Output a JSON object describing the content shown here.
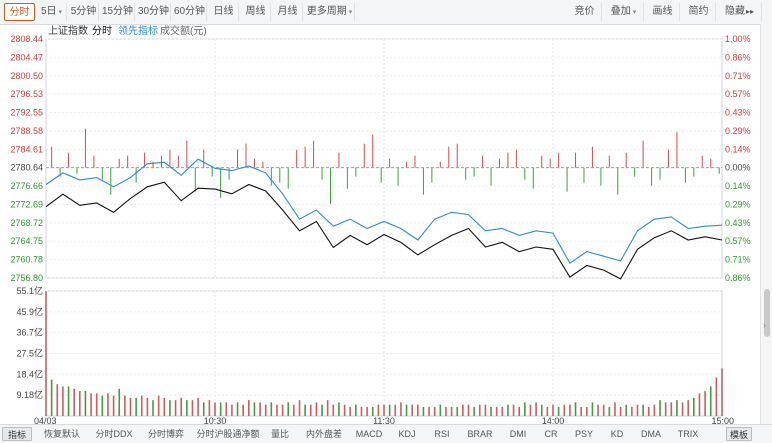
{
  "toolbar": {
    "left": [
      {
        "label": "分时",
        "active": true,
        "dropdown": false
      },
      {
        "label": "5日",
        "active": false,
        "dropdown": true
      },
      {
        "label": "5分钟",
        "active": false,
        "dropdown": false
      },
      {
        "label": "15分钟",
        "active": false,
        "dropdown": false
      },
      {
        "label": "30分钟",
        "active": false,
        "dropdown": false
      },
      {
        "label": "60分钟",
        "active": false,
        "dropdown": false
      },
      {
        "label": "日线",
        "active": false,
        "dropdown": false
      },
      {
        "label": "周线",
        "active": false,
        "dropdown": false
      },
      {
        "label": "月线",
        "active": false,
        "dropdown": false
      },
      {
        "label": "更多周期",
        "active": false,
        "dropdown": true
      }
    ],
    "right": [
      {
        "label": "竞价",
        "dropdown": false
      },
      {
        "label": "叠加",
        "dropdown": true
      },
      {
        "label": "画线",
        "dropdown": false
      },
      {
        "label": "简约",
        "dropdown": false
      },
      {
        "label": "隐藏",
        "dropdown": false,
        "icon": "double-right-arrow-icon"
      }
    ],
    "icon_glyph": "▸▸"
  },
  "legend": {
    "index_name": "上证指数",
    "line_name": "分时",
    "lead_name": "领先指标",
    "volume_name": "成交额(元)",
    "colors": {
      "line": "#111111",
      "lead": "#2b8bd8",
      "volume": "#777777"
    }
  },
  "chart_data": {
    "type": "line",
    "prev_close": 2780.64,
    "y_left_ticks": [
      "2808.44",
      "2804.47",
      "2800.50",
      "2796.53",
      "2792.55",
      "2788.58",
      "2784.61",
      "2780.64",
      "2776.66",
      "2772.69",
      "2768.72",
      "2764.75",
      "2760.78",
      "2756.80"
    ],
    "y_right_ticks": [
      "1.00%",
      "0.86%",
      "0.71%",
      "0.57%",
      "0.43%",
      "0.29%",
      "0.14%",
      "0.00%",
      "0.14%",
      "0.29%",
      "0.43%",
      "0.57%",
      "0.71%",
      "0.86%"
    ],
    "ylim": [
      2756.8,
      2808.44
    ],
    "x_labels": [
      "04/03",
      "10:30",
      "11:30",
      "14:00",
      "15:00"
    ],
    "minutes_total": 240,
    "price_series": {
      "name": "分时",
      "t": [
        0,
        6,
        12,
        18,
        24,
        30,
        36,
        42,
        48,
        54,
        60,
        66,
        72,
        78,
        84,
        90,
        96,
        102,
        108,
        114,
        120,
        126,
        132,
        138,
        144,
        150,
        156,
        162,
        168,
        174,
        180,
        186,
        192,
        198,
        204,
        210,
        216,
        222,
        228,
        234,
        240
      ],
      "values": [
        2772.2,
        2774.9,
        2772.5,
        2773.0,
        2771.0,
        2774.0,
        2776.5,
        2777.5,
        2773.5,
        2776.2,
        2776.0,
        2775.0,
        2777.0,
        2775.6,
        2771.5,
        2767.0,
        2769.0,
        2763.4,
        2766.0,
        2764.0,
        2766.2,
        2764.5,
        2761.8,
        2764.0,
        2766.0,
        2767.5,
        2763.5,
        2764.5,
        2762.5,
        2763.5,
        2763.0,
        2757.0,
        2759.5,
        2758.5,
        2756.6,
        2763.0,
        2765.5,
        2767.0,
        2765.0,
        2765.7,
        2765.0
      ]
    },
    "lead_series": {
      "name": "领先指标",
      "t": [
        0,
        6,
        12,
        18,
        24,
        30,
        36,
        42,
        48,
        54,
        60,
        66,
        72,
        78,
        84,
        90,
        96,
        102,
        108,
        114,
        120,
        126,
        132,
        138,
        144,
        150,
        156,
        162,
        168,
        174,
        180,
        186,
        192,
        198,
        204,
        210,
        216,
        222,
        228,
        234,
        240
      ],
      "values": [
        2777.0,
        2779.5,
        2778.0,
        2778.5,
        2776.5,
        2778.5,
        2781.5,
        2781.8,
        2779.0,
        2782.5,
        2780.5,
        2780.0,
        2781.0,
        2779.5,
        2775.0,
        2769.5,
        2771.5,
        2768.0,
        2769.5,
        2767.5,
        2769.0,
        2767.5,
        2765.0,
        2769.5,
        2771.0,
        2770.5,
        2767.0,
        2767.5,
        2766.0,
        2767.0,
        2766.5,
        2760.0,
        2762.5,
        2761.5,
        2760.5,
        2767.0,
        2769.5,
        2770.0,
        2767.5,
        2768.0,
        2768.2
      ]
    },
    "diff_bars": {
      "t": [
        2,
        5,
        8,
        11,
        14,
        17,
        20,
        23,
        26,
        29,
        32,
        35,
        38,
        41,
        44,
        47,
        50,
        53,
        56,
        59,
        62,
        65,
        68,
        71,
        74,
        77,
        80,
        83,
        86,
        89,
        92,
        95,
        98,
        101,
        104,
        107,
        110,
        113,
        116,
        119,
        122,
        125,
        128,
        131,
        134,
        137,
        140,
        143,
        146,
        149,
        152,
        155,
        158,
        161,
        164,
        167,
        170,
        173,
        176,
        179,
        182,
        185,
        188,
        191,
        194,
        197,
        200,
        203,
        206,
        209,
        212,
        215,
        218,
        221,
        224,
        227,
        230,
        233,
        236,
        239
      ],
      "values": [
        7,
        -3,
        5,
        -2,
        13,
        4,
        -4,
        -9,
        3,
        4,
        -5,
        5,
        2,
        4,
        6,
        4,
        9,
        -8,
        6,
        -3,
        -10,
        -4,
        6,
        8,
        3,
        2,
        -6,
        -5,
        -7,
        6,
        7,
        9,
        -4,
        -12,
        5,
        -7,
        -3,
        8,
        11,
        -5,
        3,
        -6,
        2,
        4,
        -9,
        -5,
        2,
        7,
        8,
        -4,
        -3,
        4,
        -6,
        3,
        5,
        6,
        -4,
        -7,
        4,
        3,
        5,
        -8,
        5,
        -5,
        7,
        -6,
        4,
        -9,
        5,
        -3,
        9,
        -6,
        -4,
        6,
        12,
        -5,
        -3,
        4,
        3,
        -2
      ]
    },
    "volume": {
      "y_ticks": [
        "55.1亿",
        "45.9亿",
        "36.7亿",
        "27.5亿",
        "18.4亿",
        "9.18亿"
      ],
      "ylim": [
        0,
        55.1
      ],
      "t": [
        0,
        2,
        4,
        6,
        8,
        10,
        12,
        14,
        16,
        18,
        20,
        22,
        24,
        26,
        28,
        30,
        32,
        34,
        36,
        38,
        40,
        42,
        44,
        46,
        48,
        50,
        52,
        54,
        56,
        58,
        60,
        62,
        64,
        66,
        68,
        70,
        72,
        74,
        76,
        78,
        80,
        82,
        84,
        86,
        88,
        90,
        92,
        94,
        96,
        98,
        100,
        102,
        104,
        106,
        108,
        110,
        112,
        114,
        116,
        118,
        120,
        122,
        124,
        126,
        128,
        130,
        132,
        134,
        136,
        138,
        140,
        142,
        144,
        146,
        148,
        150,
        152,
        154,
        156,
        158,
        160,
        162,
        164,
        166,
        168,
        170,
        172,
        174,
        176,
        178,
        180,
        182,
        184,
        186,
        188,
        190,
        192,
        194,
        196,
        198,
        200,
        202,
        204,
        206,
        208,
        210,
        212,
        214,
        216,
        218,
        220,
        222,
        224,
        226,
        228,
        230,
        232,
        234,
        236,
        238,
        240
      ],
      "values": [
        55,
        16,
        14,
        13,
        13,
        12,
        11,
        11,
        10,
        10,
        9,
        10,
        9,
        12,
        9,
        8,
        8,
        9,
        8,
        7,
        9,
        8,
        7,
        7,
        8,
        7,
        7,
        8,
        6,
        7,
        6,
        6,
        6,
        5,
        6,
        5,
        7,
        6,
        6,
        5,
        6,
        5,
        5,
        6,
        5,
        7,
        5,
        5,
        6,
        5,
        7,
        5,
        6,
        5,
        4,
        5,
        4,
        4,
        4,
        5,
        5,
        5,
        5,
        6,
        5,
        5,
        5,
        4,
        4,
        4,
        5,
        4,
        4,
        4,
        5,
        5,
        4,
        5,
        5,
        4,
        4,
        4,
        5,
        5,
        4,
        6,
        5,
        6,
        5,
        4,
        5,
        4,
        5,
        5,
        6,
        4,
        4,
        6,
        5,
        5,
        4,
        6,
        4,
        5,
        4,
        5,
        5,
        4,
        5,
        7,
        6,
        6,
        7,
        6,
        7,
        8,
        10,
        11,
        13,
        17,
        21,
        30
      ]
    }
  },
  "bottom_bar": {
    "items": [
      {
        "label": "指标",
        "active": true
      },
      {
        "label": "恢复默认",
        "active": false
      },
      {
        "label": "分时DDX",
        "active": false
      },
      {
        "label": "分时博弈",
        "active": false
      },
      {
        "label": "分时沪股通净额",
        "active": false
      },
      {
        "label": "量比",
        "active": false
      },
      {
        "label": "内外盘差",
        "active": false
      },
      {
        "label": "MACD",
        "active": false
      },
      {
        "label": "KDJ",
        "active": false
      },
      {
        "label": "RSI",
        "active": false
      },
      {
        "label": "BRAR",
        "active": false
      },
      {
        "label": "DMI",
        "active": false
      },
      {
        "label": "CR",
        "active": false
      },
      {
        "label": "PSY",
        "active": false
      },
      {
        "label": "KD",
        "active": false
      },
      {
        "label": "DMA",
        "active": false
      },
      {
        "label": "TRIX",
        "active": false
      },
      {
        "label": "模板",
        "active": true
      }
    ]
  }
}
